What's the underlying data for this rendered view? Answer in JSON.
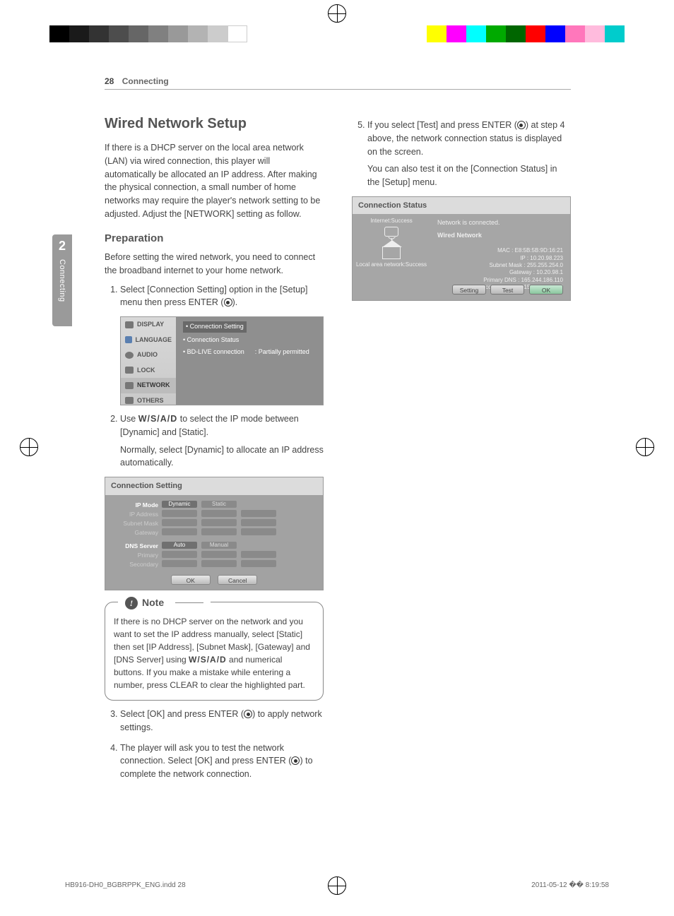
{
  "header": {
    "page_num": "28",
    "section": "Connecting"
  },
  "side_tab": {
    "chapter_num": "2",
    "chapter_label": "Connecting"
  },
  "col1": {
    "title": "Wired Network Setup",
    "intro": "If there is a DHCP server on the local area network (LAN) via wired connection, this player will automatically be allocated an IP address. After making the physical connection, a small number of home networks may require the player's network setting to be adjusted. Adjust the [NETWORK] setting as follow.",
    "prep_heading": "Preparation",
    "prep_text": "Before setting the wired network, you need to connect the broadband internet to your home network.",
    "step1_a": "Select [Connection Setting] option in the [Setup] menu then press ENTER (",
    "step1_b": ").",
    "step2_a": "Use ",
    "step2_arrows": "W/S/A/D",
    "step2_b": " to select the IP mode between [Dynamic] and [Static].",
    "step2_sub": "Normally, select [Dynamic] to allocate an IP address automatically.",
    "step3_a": "Select [OK] and press ENTER (",
    "step3_b": ") to apply network settings.",
    "step4_a": "The player will ask you to test the network connection. Select [OK] and press ENTER (",
    "step4_b": ") to complete the network connection.",
    "ui_a": {
      "sidebar": [
        "DISPLAY",
        "LANGUAGE",
        "AUDIO",
        "LOCK",
        "NETWORK",
        "OTHERS"
      ],
      "rows": [
        {
          "bullet": "•",
          "label": "Connection Setting",
          "selected": true
        },
        {
          "bullet": "•",
          "label": "Connection Status"
        },
        {
          "bullet": "•",
          "label": "BD-LIVE connection",
          "val": ": Partially permitted"
        }
      ]
    },
    "ui_b": {
      "title": "Connection Setting",
      "labels_top": [
        "IP Mode",
        "IP Address",
        "Subnet Mask",
        "Gateway"
      ],
      "opts_top": [
        "Dynamic",
        "Static"
      ],
      "labels_bot": [
        "DNS Server",
        "Primary",
        "Secondary"
      ],
      "opts_bot": [
        "Auto",
        "Manual"
      ],
      "btns": [
        "OK",
        "Cancel"
      ]
    },
    "note": {
      "label": "Note",
      "text_a": "If there is no DHCP server on the network and you want to set the IP address manually, select [Static] then set [IP Address], [Subnet Mask], [Gateway] and [DNS Server] using ",
      "arrows": "W/S/A/D",
      "text_b": " and numerical buttons. If you make a mistake while entering a number, press CLEAR to clear the highlighted part."
    }
  },
  "col2": {
    "step5_a": "If you select [Test] and press ENTER (",
    "step5_b": ") at step 4 above, the network connection status is displayed on the screen.",
    "step5_sub": "You can also test it on the [Connection Status] in the [Setup] menu.",
    "ui_c": {
      "title": "Connection Status",
      "internet": "Internet:Success",
      "lan": "Local area network:Success",
      "net_msg": "Network is connected.",
      "net_type": "Wired Network",
      "info": [
        "MAC : E8:5B:5B:9D:16:21",
        "IP : 10.20.98.223",
        "Subnet Mask : 255.255.254.0",
        "Gateway : 10.20.98.1",
        "Primary DNS : 165.244.186.110",
        "Secondary DNS : 156.147.161.32"
      ],
      "btns": [
        "Setting",
        "Test",
        "OK"
      ]
    }
  },
  "footer": {
    "file": "HB916-DH0_BGBRPPK_ENG.indd   28",
    "ts": "2011-05-12   �� 8:19:58"
  }
}
